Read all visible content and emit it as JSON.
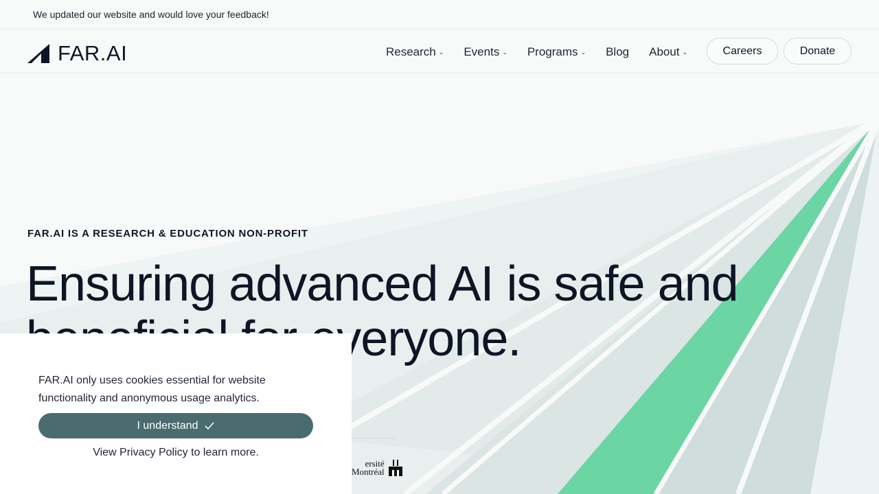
{
  "announcement": {
    "text": "We updated our website and would love your feedback!"
  },
  "header": {
    "logo_text": "FAR.AI",
    "menu": [
      {
        "label": "Research",
        "has_dropdown": true
      },
      {
        "label": "Events",
        "has_dropdown": true
      },
      {
        "label": "Programs",
        "has_dropdown": true
      },
      {
        "label": "Blog",
        "has_dropdown": false
      },
      {
        "label": "About",
        "has_dropdown": true
      }
    ],
    "careers_label": "Careers",
    "donate_label": "Donate"
  },
  "hero": {
    "eyebrow": "FAR.AI IS A RESEARCH & EDUCATION NON-PROFIT",
    "title": "Ensuring advanced AI is safe and beneficial for everyone."
  },
  "partner_logo": {
    "line1": "ersité",
    "line2": "Montréal"
  },
  "cookie_banner": {
    "message": "FAR.AI only uses cookies essential for website functionality and anonymous usage analytics.",
    "accept_label": "I understand",
    "policy_link": "View Privacy Policy",
    "policy_suffix": " to learn more."
  },
  "colors": {
    "accent_green": "#6bd5a3",
    "button_teal": "#4a6b6f",
    "text_dark": "#0e1525",
    "background": "#f8faf9"
  }
}
